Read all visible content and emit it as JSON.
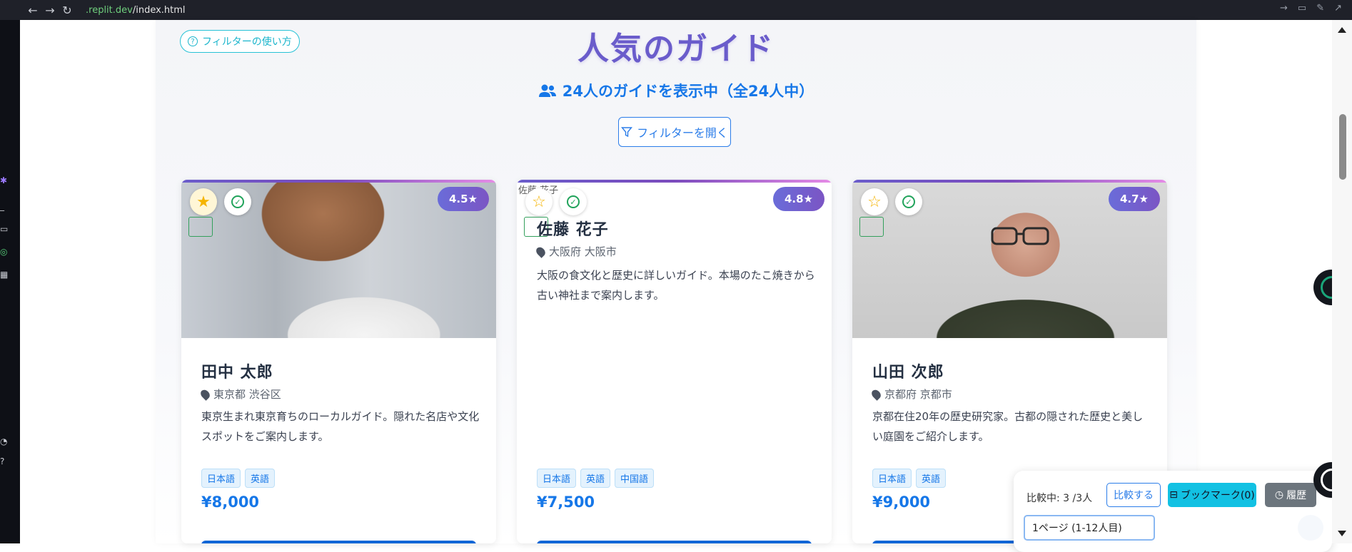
{
  "browser": {
    "url_prefix": ".replit.dev",
    "url_path": "/index.html"
  },
  "header": {
    "help_button": "フィルターの使い方",
    "title": "人気のガイド",
    "count_text": "24人のガイドを表示中（全24人中）",
    "filter_button": "フィルターを開く"
  },
  "guides": [
    {
      "name": "田中 太郎",
      "location": "東京都 渋谷区",
      "description": "東京生まれ東京育ちのローカルガイド。隠れた名店や文化スポットをご案内します。",
      "languages": [
        "日本語",
        "英語"
      ],
      "price": "¥8,000",
      "rating": "4.5★",
      "favorited": true,
      "photo": "smiling-man-photo"
    },
    {
      "name": "佐藤 花子",
      "location": "大阪府 大阪市",
      "description": "大阪の食文化と歴史に詳しいガイド。本場のたこ焼きから古い神社まで案内します。",
      "languages": [
        "日本語",
        "英語",
        "中国語"
      ],
      "price": "¥7,500",
      "rating": "4.8★",
      "favorited": false,
      "photo_alt": "佐藤 花子"
    },
    {
      "name": "山田 次郎",
      "location": "京都府 京都市",
      "description": "京都在住20年の歴史研究家。古都の隠された歴史と美しい庭園をご紹介します。",
      "languages": [
        "日本語",
        "英語"
      ],
      "price": "¥9,000",
      "rating": "4.7★",
      "favorited": false,
      "photo": "man-with-glasses-photo"
    }
  ],
  "compare_panel": {
    "status": "比較中: 3 /3人",
    "compare_button": "比較する",
    "bookmark_button": "ブックマーク(0)",
    "history_button": "履歴",
    "page_select": "1ページ (1-12人目)"
  },
  "colors": {
    "title": "#6a5ccb",
    "accent": "#1677e8",
    "help": "#1bb5cc",
    "bookmark": "#12c1e3",
    "history": "#6c757d"
  }
}
